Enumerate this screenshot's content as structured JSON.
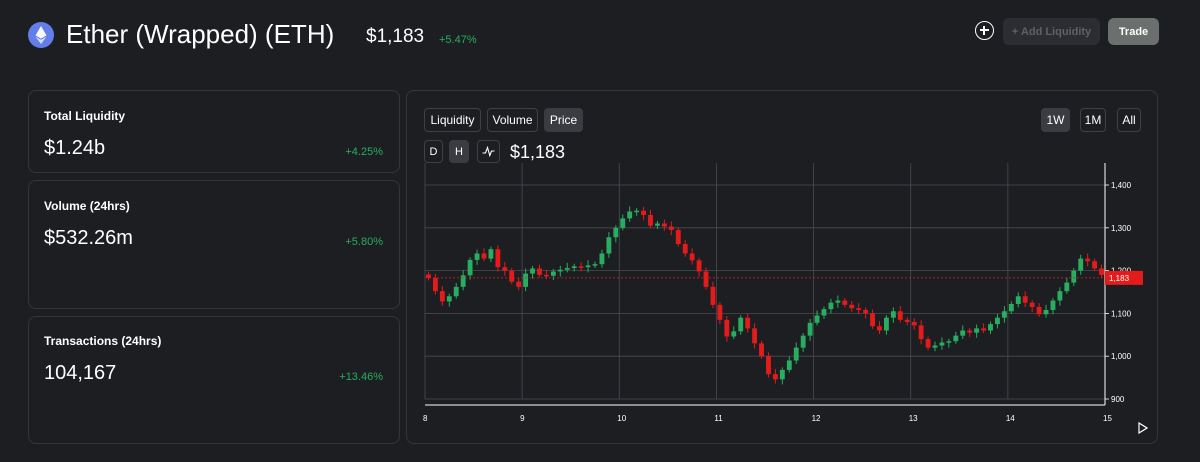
{
  "token": {
    "name": "Ether (Wrapped) (ETH)",
    "price": "$1,183",
    "change": "+5.47%"
  },
  "header_actions": {
    "add_liquidity_label": "+ Add Liquidity",
    "trade_label": "Trade",
    "add_icon": "plus-circle-icon"
  },
  "stats": [
    {
      "label": "Total Liquidity",
      "value": "$1.24b",
      "change": "+4.25%"
    },
    {
      "label": "Volume (24hrs)",
      "value": "$532.26m",
      "change": "+5.80%"
    },
    {
      "label": "Transactions (24hrs)",
      "value": "104,167",
      "change": "+13.46%"
    }
  ],
  "chart_panel": {
    "tabs": [
      {
        "label": "Liquidity",
        "active": false
      },
      {
        "label": "Volume",
        "active": false
      },
      {
        "label": "Price",
        "active": true
      }
    ],
    "ranges": [
      {
        "label": "1W",
        "active": true
      },
      {
        "label": "1M",
        "active": false
      },
      {
        "label": "All",
        "active": false
      }
    ],
    "intervals": [
      {
        "label": "D",
        "active": false
      },
      {
        "label": "H",
        "active": true
      }
    ],
    "line_toggle_icon": "line-chart-icon",
    "current_price": "$1,183",
    "play_icon": "play-icon"
  },
  "colors": {
    "background": "#1d1e22",
    "up": "#27ae60",
    "down": "#e31b1b",
    "price_marker": "#e31b1b",
    "grid": "#4a4c52"
  },
  "chart_data": {
    "type": "candlestick",
    "x_tick_labels": [
      "8",
      "9",
      "10",
      "11",
      "12",
      "13",
      "14",
      "15"
    ],
    "y_tick_labels": [
      "1,400",
      "1,300",
      "1,200",
      "1,100",
      "1,000",
      "900"
    ],
    "ylim": [
      900,
      1400
    ],
    "current_price_label": "1,183",
    "current_price": 1183,
    "close_series": [
      1183,
      1152,
      1128,
      1140,
      1162,
      1189,
      1225,
      1240,
      1228,
      1250,
      1208,
      1200,
      1174,
      1162,
      1193,
      1205,
      1190,
      1188,
      1198,
      1202,
      1206,
      1210,
      1208,
      1212,
      1215,
      1240,
      1278,
      1300,
      1322,
      1338,
      1340,
      1330,
      1305,
      1310,
      1303,
      1295,
      1262,
      1240,
      1224,
      1198,
      1162,
      1120,
      1085,
      1046,
      1058,
      1090,
      1065,
      1030,
      1000,
      958,
      946,
      968,
      990,
      1020,
      1048,
      1078,
      1095,
      1110,
      1125,
      1130,
      1120,
      1112,
      1108,
      1100,
      1070,
      1060,
      1090,
      1105,
      1085,
      1080,
      1072,
      1040,
      1020,
      1025,
      1032,
      1035,
      1048,
      1060,
      1055,
      1065,
      1060,
      1075,
      1090,
      1105,
      1122,
      1140,
      1125,
      1115,
      1098,
      1108,
      1130,
      1152,
      1172,
      1200,
      1228,
      1222,
      1205,
      1190
    ]
  }
}
